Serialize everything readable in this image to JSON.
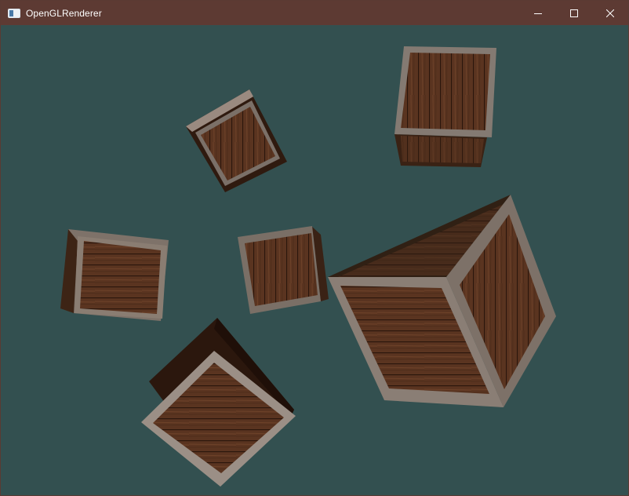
{
  "window": {
    "title": "OpenGLRenderer",
    "titlebar_color": "#5d3a33",
    "app_icon": "window-app-icon"
  },
  "controls": {
    "minimize_icon": "minimize-icon",
    "maximize_icon": "maximize-icon",
    "close_icon": "close-icon"
  },
  "viewport": {
    "clear_color": "#335050",
    "object": "wooden-crate",
    "crate_count": 6
  }
}
